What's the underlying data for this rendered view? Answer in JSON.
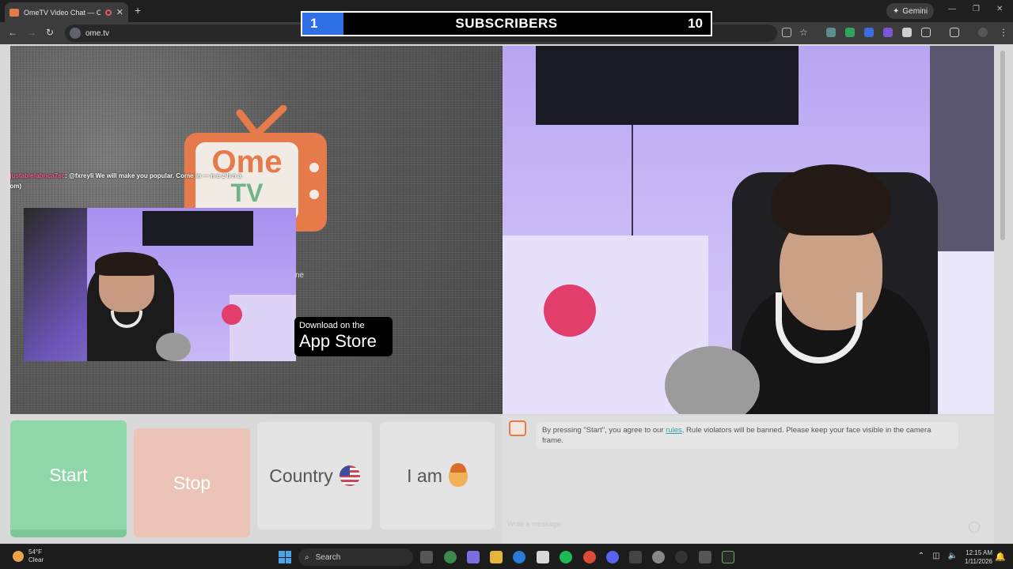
{
  "browser": {
    "tab_title": "OmeTV Video Chat — Ome",
    "tab_close": "✕",
    "new_tab": "+",
    "gemini_label": "Gemini",
    "url": "ome.tv",
    "window_controls": [
      "—",
      "❐",
      "✕"
    ]
  },
  "subscribers_overlay": {
    "start_value": "1",
    "label": "SUBSCRIBERS",
    "goal_value": "10",
    "progress_fraction": 0.1
  },
  "video_left": {
    "logo_text_top": "Ome",
    "logo_text_bottom": "TV",
    "chat_username": "adjustablefabrica7sc",
    "chat_message": ": @fxreyli We will make you popular. Come in — n e z h n a (.com)",
    "stray_text": "ne",
    "appstore_small": "Download on the",
    "appstore_big": "App Store"
  },
  "controls": {
    "start_label": "Start",
    "stop_label": "Stop",
    "country_label": "Country",
    "iam_label": "I am"
  },
  "chat": {
    "notice_prefix": "By pressing \"Start\", you agree to our ",
    "notice_link": "rules",
    "notice_suffix": ". Rule violators will be banned. Please keep your face visible in the camera frame.",
    "input_placeholder": "Write a message"
  },
  "taskbar": {
    "temperature": "54°F",
    "weather": "Clear",
    "search_label": "Search",
    "time": "12:15 AM",
    "date": "1/11/2026"
  },
  "colors": {
    "ome_orange": "#e67a4a",
    "start_green": "#8fd6a8",
    "stop_peach": "#ebc3b7",
    "sub_fill_blue": "#2f6fe6"
  }
}
